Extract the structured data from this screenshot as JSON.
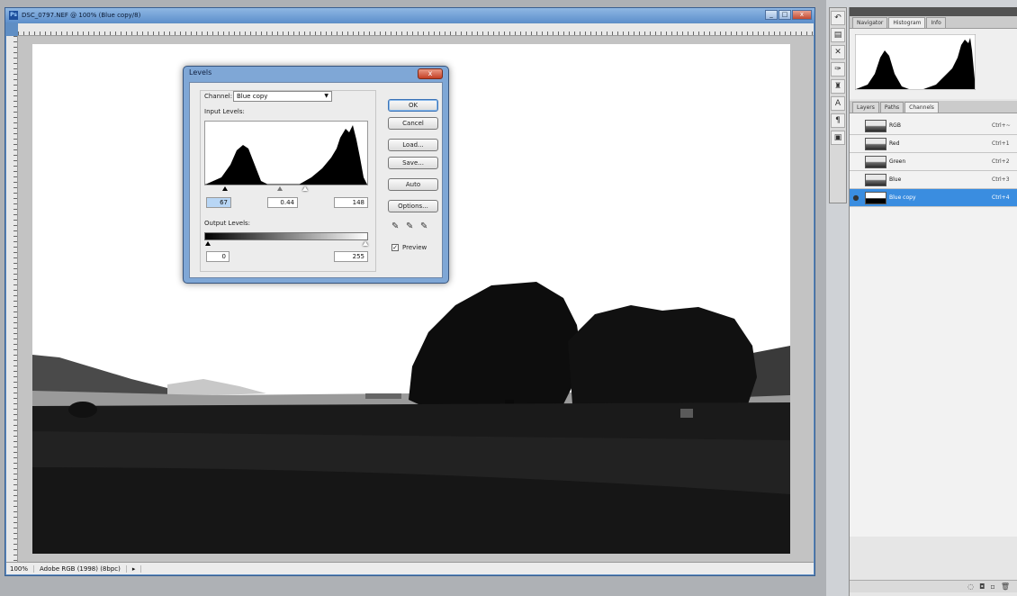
{
  "document": {
    "title": "DSC_0797.NEF @ 100% (Blue copy/8)",
    "status_zoom": "100%",
    "status_info": "Adobe RGB (1998) (8bpc)",
    "window_buttons": [
      "_",
      "□",
      "x"
    ]
  },
  "levels_dialog": {
    "title": "Levels",
    "close": "x",
    "channel_label": "Channel:",
    "channel_value": "Blue copy",
    "input_levels_label": "Input Levels:",
    "input_black": "67",
    "input_gamma": "0.44",
    "input_white": "148",
    "output_levels_label": "Output Levels:",
    "output_black": "0",
    "output_white": "255",
    "buttons": {
      "ok": "OK",
      "cancel": "Cancel",
      "load": "Load...",
      "save": "Save...",
      "auto": "Auto",
      "options": "Options..."
    },
    "preview_label": "Preview",
    "preview_checked": true
  },
  "panels": {
    "histogram_tabs": [
      "Navigator",
      "Histogram",
      "Info"
    ],
    "histogram_active": "Histogram",
    "channel_tabs": [
      "Layers",
      "Paths",
      "Channels"
    ],
    "channel_active": "Channels",
    "channels": [
      {
        "name": "RGB",
        "shortcut": "Ctrl+~",
        "visible": false,
        "selected": false
      },
      {
        "name": "Red",
        "shortcut": "Ctrl+1",
        "visible": false,
        "selected": false
      },
      {
        "name": "Green",
        "shortcut": "Ctrl+2",
        "visible": false,
        "selected": false
      },
      {
        "name": "Blue",
        "shortcut": "Ctrl+3",
        "visible": false,
        "selected": false
      },
      {
        "name": "Blue copy",
        "shortcut": "Ctrl+4",
        "visible": true,
        "selected": true
      }
    ],
    "footer_icons": [
      "load-selection-icon",
      "save-selection-icon",
      "new-channel-icon",
      "delete-channel-icon"
    ]
  },
  "tools": [
    "history-brush-icon",
    "layer-comp-icon",
    "crossed-tools-icon",
    "brush-icon",
    "stamp-icon",
    "text-a-icon",
    "paragraph-icon",
    "image-icon"
  ],
  "colors": {
    "window_blue": "#5f8ec4",
    "selection_blue": "#3a8de0",
    "panel_gray": "#e6e6e6"
  }
}
